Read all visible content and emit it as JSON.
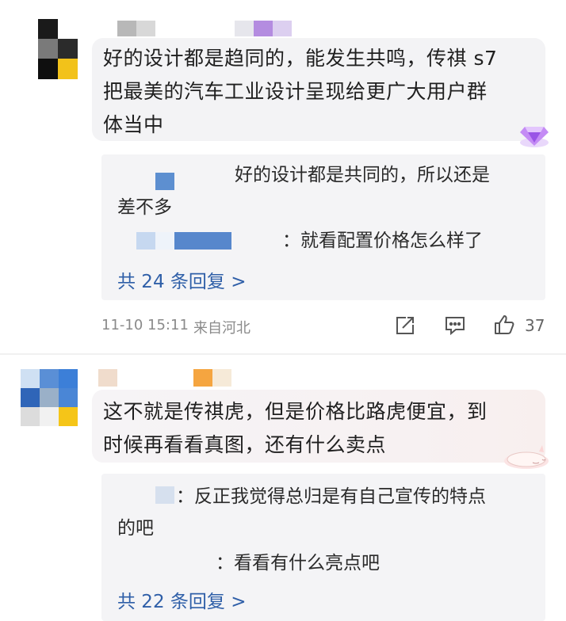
{
  "comment1": {
    "text_lines": [
      "好的设计都是趋同的，能发生共鸣，传祺 s7",
      "把最美的汽车工业设计呈现给更广大用户群",
      "体当中"
    ],
    "replies": [
      {
        "text_lines": [
          "好的设计都是共同的，所以还是",
          "差不多"
        ]
      },
      {
        "text": "：就看配置价格怎么样了"
      }
    ],
    "more_replies": "共 24 条回复 >",
    "timestamp": "11-10 15:11",
    "location": "来自河北",
    "like_count": "37"
  },
  "comment2": {
    "text_lines": [
      "这不就是传祺虎，但是价格比路虎便宜，到",
      "时候再看看真图，还有什么卖点"
    ],
    "replies": [
      {
        "text_lines": [
          "：反正我觉得总归是有自己宣传的特点",
          "的吧"
        ]
      },
      {
        "text": "：看看有什么亮点吧"
      }
    ],
    "more_replies": "共 22 条回复 >"
  },
  "colors": {
    "link": "#2f5fa8",
    "meta": "#8a8a8a",
    "bubble": "#f3f3f5",
    "badge": "#b06cf0"
  },
  "icons": [
    "share-icon",
    "comment-icon",
    "thumbs-up-icon",
    "diamond-badge-icon",
    "sleeping-cat-sticker-icon"
  ]
}
